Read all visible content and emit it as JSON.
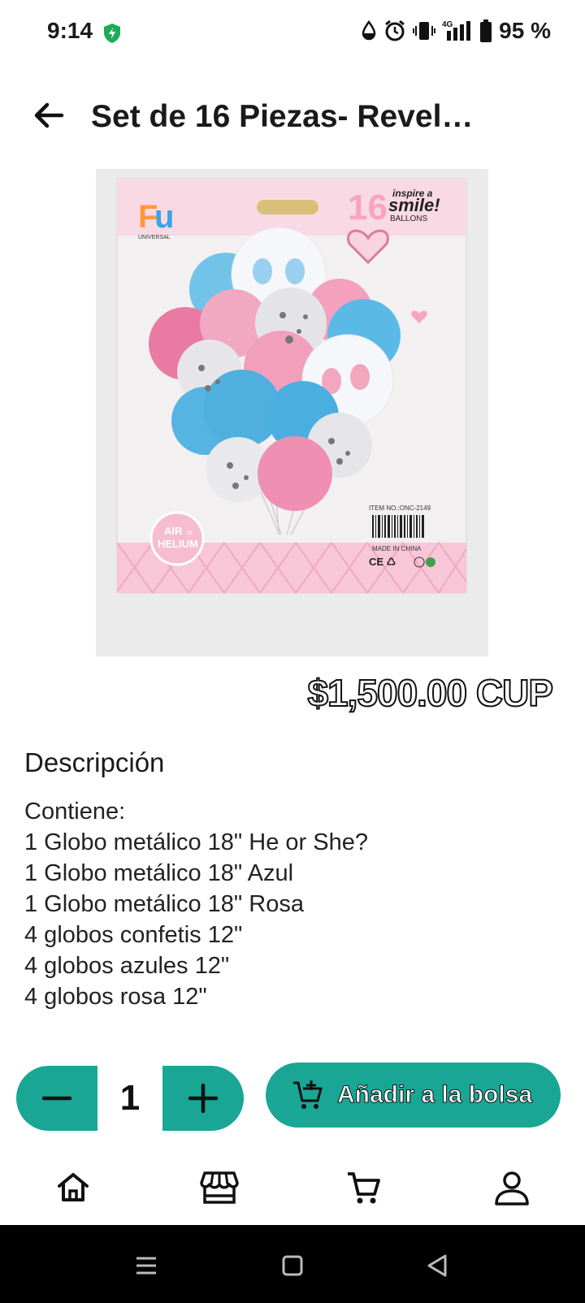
{
  "status_bar": {
    "time": "9:14",
    "battery": "95 %",
    "network": "4G",
    "icons": [
      "shield-icon",
      "drop-icon",
      "alarm-icon",
      "vibrate-icon",
      "signal-icon",
      "battery-icon"
    ]
  },
  "header": {
    "title": "Set de 16 Piezas- Revel…",
    "back_icon": "arrow-left-icon"
  },
  "product": {
    "image_alt": "Balloon pack photo",
    "image_labels": {
      "brand": "UNIVERSAL",
      "inspire": "inspire a",
      "smile": "smile!",
      "ballons": "BALLONS",
      "count": "16",
      "item_no": "ITEM NO.:ONC-2149",
      "made_in": "MADE IN CHINA",
      "air": "AIR",
      "or": "or",
      "helium": "HELIUM"
    },
    "price": "$1,500.00 CUP"
  },
  "description": {
    "title": "Descripción",
    "body": "Contiene:\n1 Globo metálico 18\" He or She?\n1 Globo metálico 18\" Azul\n1 Globo metálico 18\" Rosa\n4 globos confetis 12\"\n4 globos azules 12\"\n4 globos rosa 12\""
  },
  "cart_controls": {
    "quantity": "1",
    "add_label": "Añadir a la bolsa"
  },
  "bottom_nav": {
    "items": [
      "home-icon",
      "store-icon",
      "cart-icon",
      "profile-icon"
    ]
  },
  "colors": {
    "accent": "#19a695",
    "pink": "#f2a7bf",
    "blue": "#6cc3e8"
  }
}
